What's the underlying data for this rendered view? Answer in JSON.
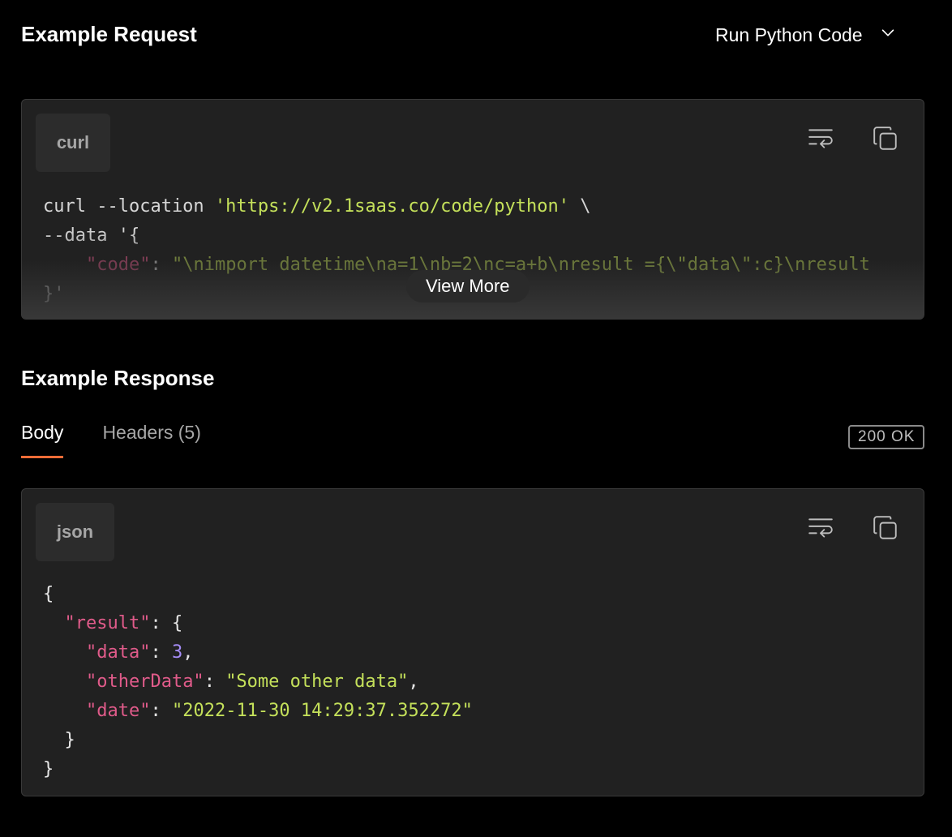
{
  "request": {
    "title": "Example Request",
    "example_select": "Run Python Code",
    "lang": "curl",
    "code": {
      "line1_cmd": "curl --location ",
      "line1_url": "'https://v2.1saas.co/code/python'",
      "line1_tail": " \\",
      "line2": "--data '{",
      "line3_key": "\"code\"",
      "line3_colon": ": ",
      "line3_val": "\"\\nimport datetime\\na=1\\nb=2\\nc=a+b\\nresult ={\\\"data\\\":c}\\nresult",
      "line4": "}'"
    },
    "view_more": "View More"
  },
  "response": {
    "title": "Example Response",
    "tabs": {
      "body": "Body",
      "headers": "Headers (5)"
    },
    "status": "200 OK",
    "lang": "json",
    "json": {
      "open": "{",
      "result_key": "\"result\"",
      "result_open": ": {",
      "data_key": "\"data\"",
      "data_val": "3",
      "other_key": "\"otherData\"",
      "other_val": "\"Some other data\"",
      "date_key": "\"date\"",
      "date_val": "\"2022-11-30 14:29:37.352272\"",
      "inner_close": "}",
      "close": "}"
    }
  },
  "icons": {
    "chevron": "chevron-down-icon",
    "wrap": "wrap-text-icon",
    "copy": "copy-icon"
  },
  "colors": {
    "background": "#000000",
    "card": "#212121",
    "accent": "#ff6c37",
    "string": "#c4e05a",
    "key": "#e05b8a",
    "number": "#a58cf6"
  }
}
